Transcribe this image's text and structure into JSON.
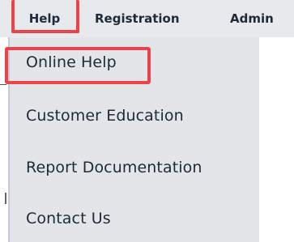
{
  "menubar": {
    "help_label": "Help",
    "registration_label": "Registration",
    "admin_label": "Admin"
  },
  "dropdown": {
    "items": [
      {
        "label": "Online Help"
      },
      {
        "label": "Customer Education"
      },
      {
        "label": "Report Documentation"
      },
      {
        "label": "Contact Us"
      }
    ]
  },
  "colors": {
    "highlight": "#e9444c",
    "menubar_bg": "#e8e9ec",
    "dropdown_bg": "#e4e5e9",
    "text": "#1c2a3a"
  }
}
